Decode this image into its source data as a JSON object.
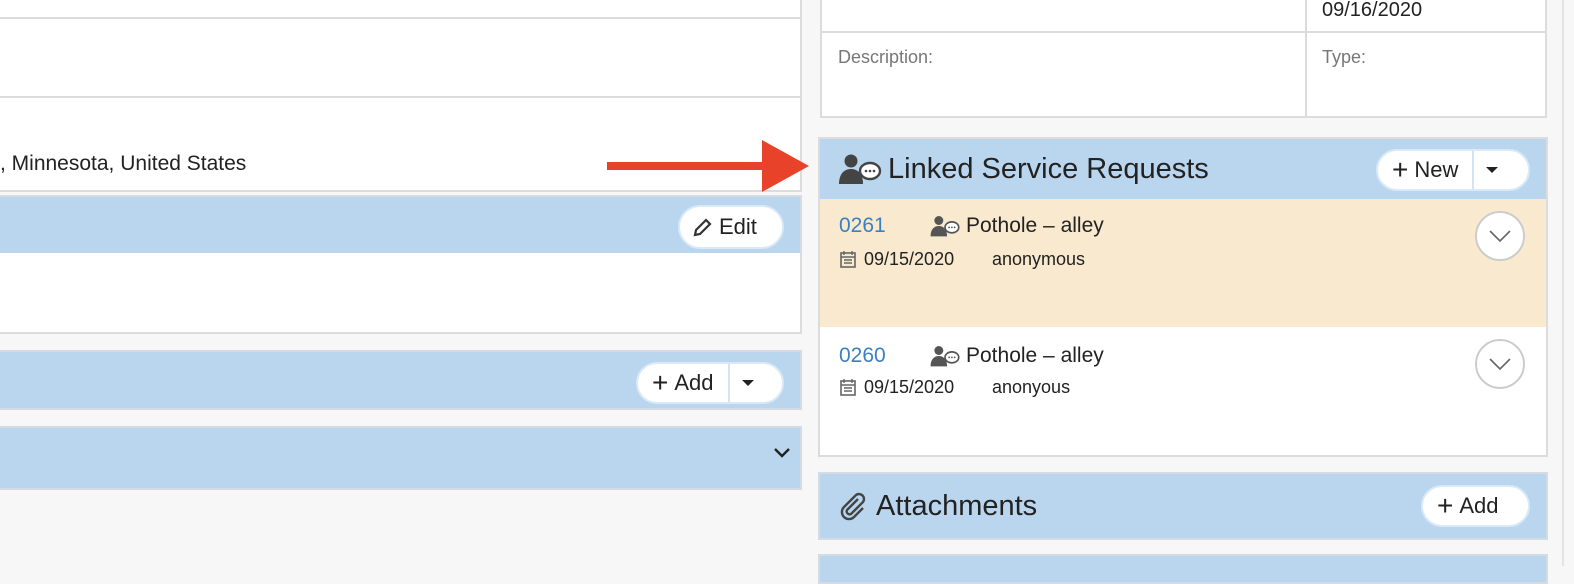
{
  "left": {
    "address_text": ", Minnesota, United States",
    "edit_label": "Edit",
    "add_label": "Add"
  },
  "right": {
    "top_table": {
      "date": "09/16/2020",
      "description_label": "Description:",
      "type_label": "Type:"
    },
    "linked_requests": {
      "title": "Linked Service Requests",
      "new_label": "New",
      "items": [
        {
          "id": "0261",
          "title": "Pothole – alley",
          "date": "09/15/2020",
          "reporter": "anonymous",
          "highlighted": true
        },
        {
          "id": "0260",
          "title": "Pothole – alley",
          "date": "09/15/2020",
          "reporter": "anonyous",
          "highlighted": false
        }
      ]
    },
    "attachments": {
      "title": "Attachments",
      "add_label": "Add"
    }
  },
  "colors": {
    "section_header": "#bad6ee",
    "highlight_row": "#f8e9cf",
    "link": "#3b7fc4",
    "arrow": "#e8432a"
  },
  "icons": [
    "user-chat-icon",
    "calendar-icon",
    "pencil-icon",
    "plus-icon",
    "chevron-down-icon",
    "paperclip-icon",
    "red-arrow"
  ]
}
